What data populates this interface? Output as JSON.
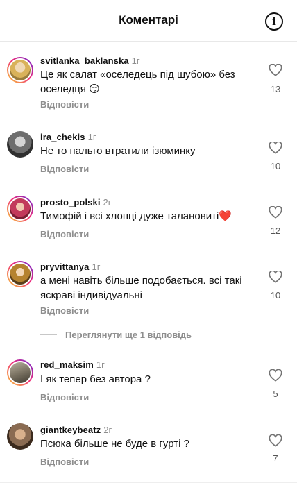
{
  "header": {
    "title": "Коментарі",
    "info_icon": "info-icon"
  },
  "comments": [
    {
      "user": "svitlanka_baklanska",
      "time": "1г",
      "text": "Це як  салат  «оселедець під шубою» без оселедця 😏",
      "reply": "Відповісти",
      "likes": "13",
      "avatar_color": "#d9b25a"
    },
    {
      "user": "ira_chekis",
      "time": "1г",
      "text": "Не то пальто втратили ізюминку",
      "reply": "Відповісти",
      "likes": "10",
      "avatar_color": "#6e6e6e"
    },
    {
      "user": "prosto_polski",
      "time": "2г",
      "text": "Тимофій і всі хлопці дуже талановиті❤️",
      "reply": "Відповісти",
      "likes": "12",
      "avatar_color": "#c23a5b"
    },
    {
      "user": "pryvittanya",
      "time": "1г",
      "text": "а мені навіть більше подобається. всі такі яскраві індивідуальні",
      "reply": "Відповісти",
      "likes": "10",
      "avatar_color": "#b5822f"
    },
    {
      "user": "red_maksim",
      "time": "1г",
      "text": "І як тепер без автора ?",
      "reply": "Відповісти",
      "likes": "5",
      "avatar_color": "#7c7464"
    },
    {
      "user": "giantkeybeatz",
      "time": "2г",
      "text": "Псюка більше не буде в гурті ?",
      "reply": "Відповісти",
      "likes": "7",
      "avatar_color": "#8a6b52"
    }
  ],
  "more_replies": "Переглянути ще 1 відповідь",
  "icons": {
    "like": "heart-outline-icon",
    "info": "info-icon"
  }
}
